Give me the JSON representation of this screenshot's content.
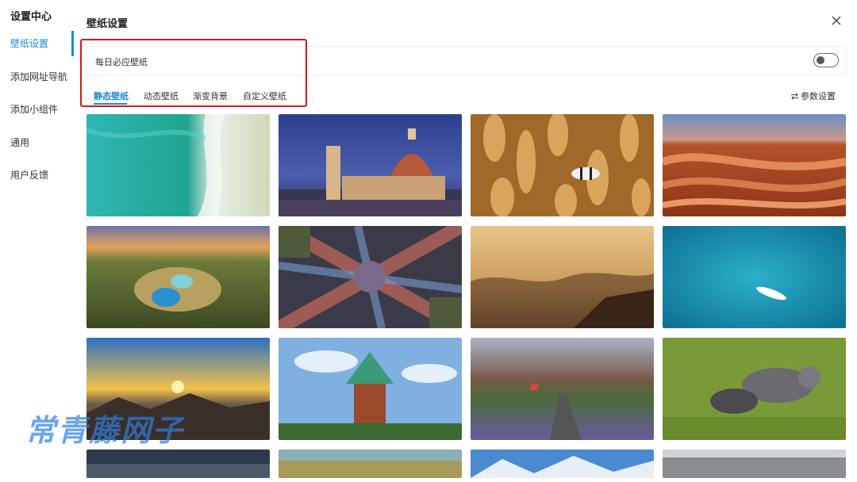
{
  "sidebar": {
    "title": "设置中心",
    "items": [
      {
        "label": "壁纸设置",
        "active": true
      },
      {
        "label": "添加网址导航",
        "active": false
      },
      {
        "label": "添加小组件",
        "active": false
      },
      {
        "label": "通用",
        "active": false
      },
      {
        "label": "用户反馈",
        "active": false
      }
    ]
  },
  "header": {
    "title": "壁纸设置",
    "close_icon": "close-icon"
  },
  "daily": {
    "label": "每日必应壁纸",
    "toggle_on": false
  },
  "tabs": [
    {
      "label": "静态壁纸",
      "active": true
    },
    {
      "label": "动态壁纸",
      "active": false
    },
    {
      "label": "渐变背景",
      "active": false
    },
    {
      "label": "自定义壁纸",
      "active": false
    }
  ],
  "params_button": {
    "label": "参数设置",
    "icon": "swap-arrows-icon"
  },
  "colors": {
    "accent": "#1d8bd6",
    "highlight_border": "#d9161c"
  },
  "watermark": "常青藤网子",
  "wallpapers": [
    "aerial-beach",
    "florence-duomo-night",
    "anemone-clownfish",
    "red-sandstone-waves",
    "crater-lakes",
    "city-intersection-aerial",
    "misty-valley-sunrise",
    "turquoise-sea-boat",
    "mountain-sunset-rocks",
    "brick-water-tower",
    "volcanic-road-lupines",
    "arctic-foxes",
    "dark-lake",
    "rocky-coast",
    "snowy-mountains",
    "winter-forest"
  ]
}
